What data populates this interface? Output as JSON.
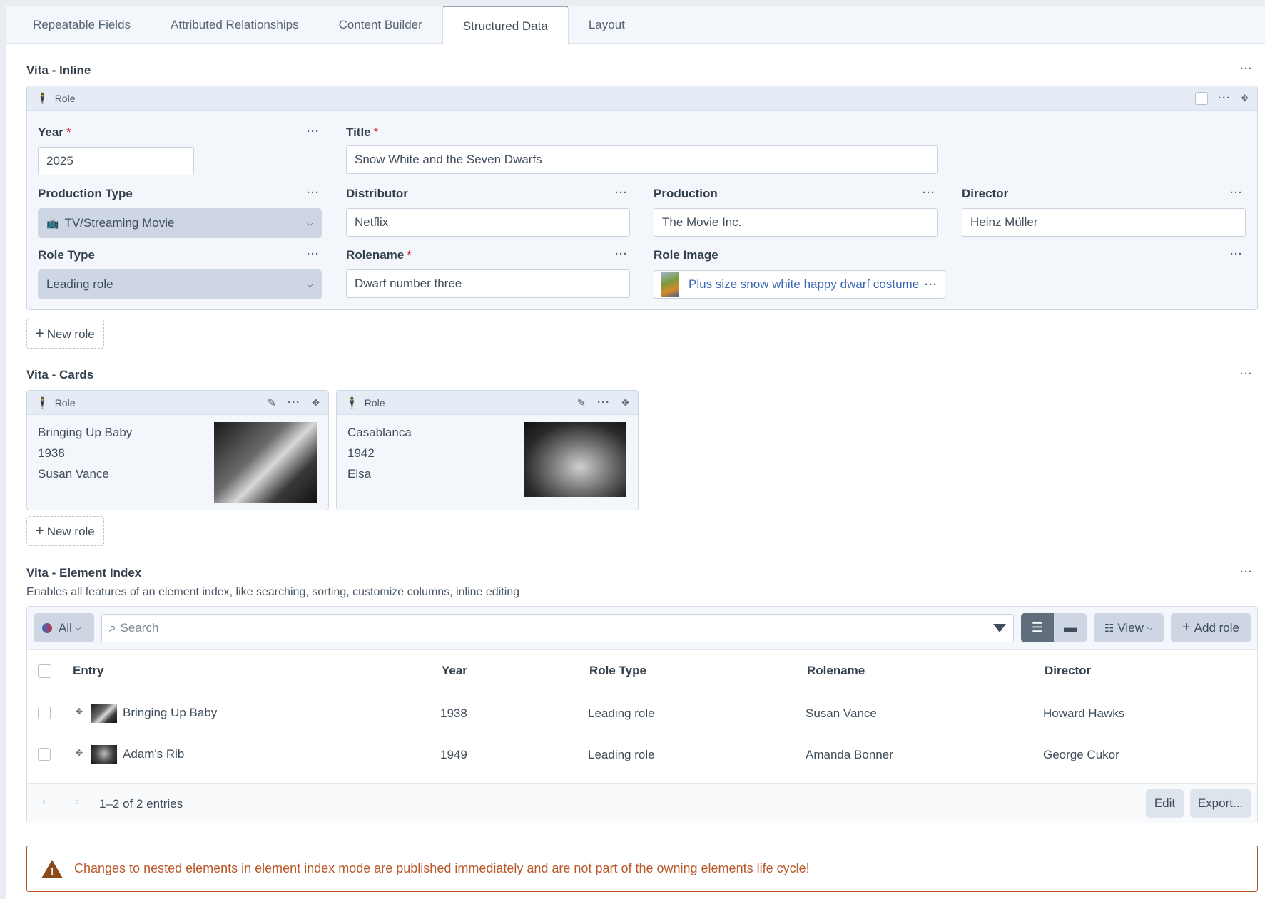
{
  "tabs": [
    "Repeatable Fields",
    "Attributed Relationships",
    "Content Builder",
    "Structured Data",
    "Layout"
  ],
  "inline": {
    "title": "Vita - Inline",
    "block_type": "Role",
    "fields": {
      "year_label": "Year",
      "year_value": "2025",
      "title_label": "Title",
      "title_value": "Snow White and the Seven Dwarfs",
      "production_type_label": "Production Type",
      "production_type_value": "TV/Streaming Movie",
      "distributor_label": "Distributor",
      "distributor_value": "Netflix",
      "production_label": "Production",
      "production_value": "The Movie Inc.",
      "director_label": "Director",
      "director_value": "Heinz Müller",
      "role_type_label": "Role Type",
      "role_type_value": "Leading role",
      "rolename_label": "Rolename",
      "rolename_value": "Dwarf number three",
      "role_image_label": "Role Image",
      "role_image_value": "Plus size snow white happy dwarf costume"
    },
    "required_marker": "*",
    "new_button": "New role"
  },
  "cards": {
    "title": "Vita - Cards",
    "items": [
      {
        "type": "Role",
        "title": "Bringing Up Baby",
        "year": "1938",
        "role": "Susan Vance"
      },
      {
        "type": "Role",
        "title": "Casablanca",
        "year": "1942",
        "role": "Elsa"
      }
    ],
    "new_button": "New role"
  },
  "index": {
    "title": "Vita - Element Index",
    "description": "Enables all features of an element index, like searching, sorting, customize columns, inline editing",
    "status_filter": "All",
    "search_placeholder": "Search",
    "view_label": "View",
    "add_button": "Add role",
    "columns": [
      "Entry",
      "Year",
      "Role Type",
      "Rolename",
      "Director"
    ],
    "rows": [
      {
        "entry": "Bringing Up Baby",
        "year": "1938",
        "role_type": "Leading role",
        "rolename": "Susan Vance",
        "director": "Howard Hawks"
      },
      {
        "entry": "Adam's Rib",
        "year": "1949",
        "role_type": "Leading role",
        "rolename": "Amanda Bonner",
        "director": "George Cukor"
      }
    ],
    "pagination": "1–2 of 2 entries",
    "edit_button": "Edit",
    "export_button": "Export..."
  },
  "warning": "Changes to nested elements in element index mode are published immediately and are not part of the owning elements life cycle!",
  "colors": {
    "accent_link": "#3a67b4",
    "required": "#cf1124",
    "warning": "#b9582a",
    "active_toggle": "#5c6b7a"
  }
}
